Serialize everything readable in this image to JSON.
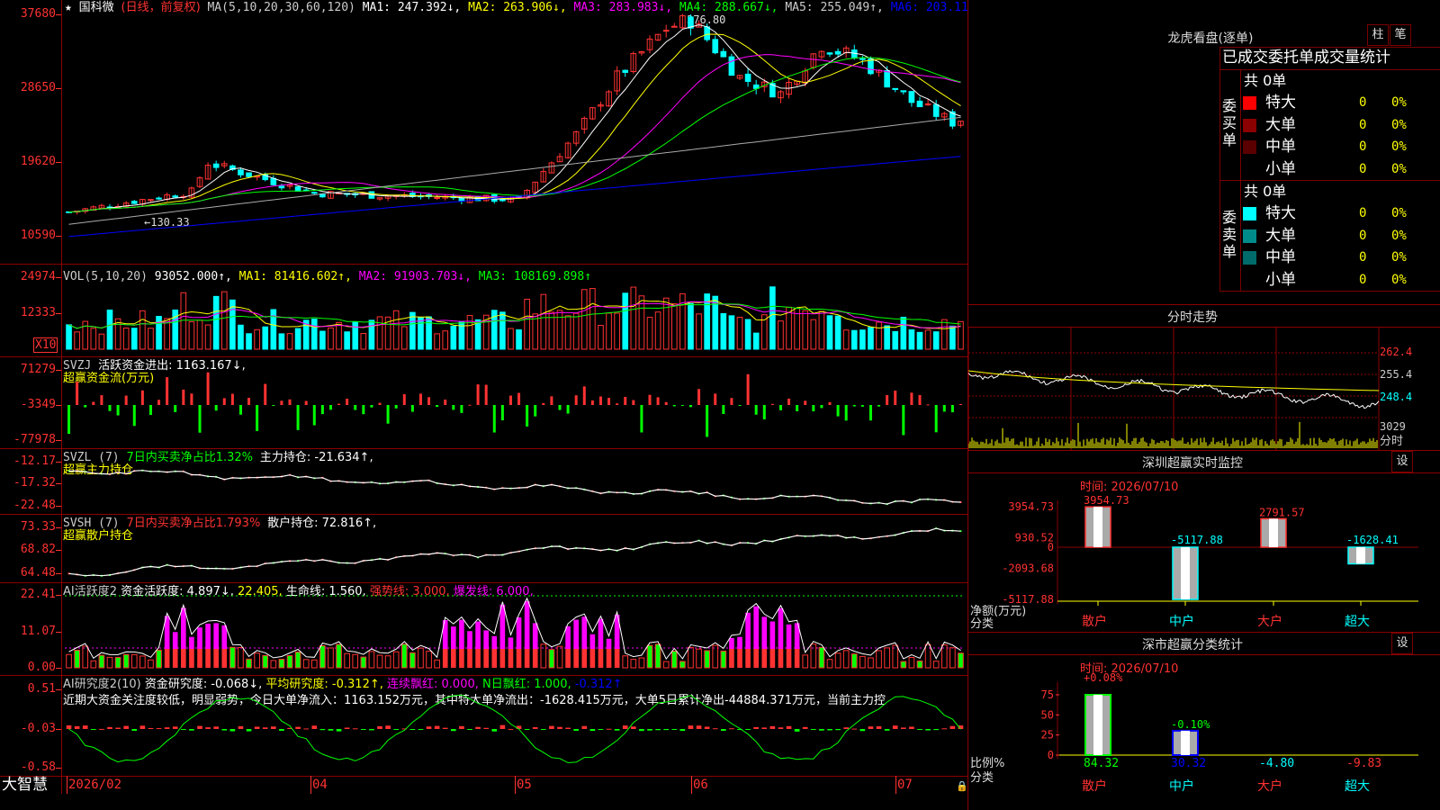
{
  "colors": {
    "up": "#ff3232",
    "down": "#00ffff",
    "bg": "#000000",
    "grid": "#8b0000",
    "ma1": "#ffffff",
    "ma2": "#ffff00",
    "ma3": "#ff00ff",
    "ma4": "#00ff00",
    "ma5": "#aaaaaa",
    "ma6": "#0000ff",
    "magenta": "#ff00ff",
    "green": "#00ff00",
    "yellow": "#ffff00"
  },
  "main": {
    "star": "★",
    "name": "国科微",
    "mode": "(日线，前复权)",
    "ma_label": "MA(5,10,20,30,60,120)",
    "ma1": "MA1: 247.392↓,",
    "ma2": "MA2: 263.906↓,",
    "ma3": "MA3: 283.983↓,",
    "ma4": "MA4: 288.667↓,",
    "ma5": "MA5: 255.049↑,",
    "ma6": "MA6: 203.11",
    "high_mark": "376.80",
    "low_mark": "←130.33",
    "y_labels": [
      "37680",
      "28650",
      "19620",
      "10590"
    ]
  },
  "vol": {
    "label": "VOL(5,10,20)",
    "value": "93052.000↑,",
    "ma1": "MA1: 81416.602↑,",
    "ma2": "MA2: 91903.703↓,",
    "ma3": "MA3: 108169.898↑",
    "y_labels": [
      "24974",
      "12333"
    ],
    "unit": "X10"
  },
  "svzj": {
    "label": "SVZJ",
    "desc": "活跃资金进出: 1163.167↓,",
    "sub": "超赢资金流(万元)",
    "y_labels": [
      "71279",
      "-3349",
      "-77978"
    ]
  },
  "svzl": {
    "label": "SVZL (7)",
    "desc": "7日内买卖净占比1.32%",
    "desc2": "主力持仓: -21.634↑,",
    "sub": "超赢主力持仓",
    "y_labels": [
      "-12.17",
      "-17.32",
      "-22.48"
    ]
  },
  "svsh": {
    "label": "SVSH (7)",
    "desc": "7日内买卖净占比1.793%",
    "desc2": "散户持仓: 72.816↑,",
    "sub": "超赢散户持仓",
    "y_labels": [
      "73.33",
      "68.82",
      "64.48"
    ]
  },
  "ai1": {
    "label": "AI活跃度2",
    "desc": "资金活跃度: 4.897↓,",
    "v2": "22.405,",
    "life": "生命线: 1.560,",
    "strong": "强势线: 3.000,",
    "burst": "爆发线: 6.000,",
    "y_labels": [
      "22.41",
      "11.07",
      "0.00"
    ]
  },
  "ai2": {
    "label": "AI研究度2(10)",
    "desc": "资金研究度: -0.068↓,",
    "avg": "平均研究度: -0.312↑,",
    "cont": "连续飘红: 0.000,",
    "nday": "N日飘红: 1.000,",
    "last": "-0.312↑",
    "comment": "近期大资金关注度较低，明显弱势，今日大单净流入：1163.152万元，其中特大单净流出：-1628.415万元，大单5日累计净出-44884.371万元，当前主力控",
    "y_labels": [
      "0.51",
      "-0.03",
      "-0.58"
    ]
  },
  "footer": {
    "brand": "大智慧",
    "dates": [
      "2026/02",
      "04",
      "05",
      "06",
      "07"
    ]
  },
  "dragon": {
    "title": "龙虎看盘(逐单)",
    "btn_bar": "柱",
    "btn_tick": "笔",
    "header": "已成交委托单成交量统计",
    "buy_label": "委买单",
    "sell_label": "委卖单",
    "buy_total": "共 0单",
    "sell_total": "共 0单",
    "buy_rows": [
      {
        "name": "特大",
        "count": "0",
        "pct": "0%",
        "color": "#ff0000"
      },
      {
        "name": "大单",
        "count": "0",
        "pct": "0%",
        "color": "#8b0000"
      },
      {
        "name": "中单",
        "count": "0",
        "pct": "0%",
        "color": "#5a0000"
      },
      {
        "name": "小单",
        "count": "0",
        "pct": "0%",
        "color": ""
      }
    ],
    "sell_rows": [
      {
        "name": "特大",
        "count": "0",
        "pct": "0%",
        "color": "#00ffff"
      },
      {
        "name": "大单",
        "count": "0",
        "pct": "0%",
        "color": "#008b8b"
      },
      {
        "name": "中单",
        "count": "0",
        "pct": "0%",
        "color": "#006b6b"
      },
      {
        "name": "小单",
        "count": "0",
        "pct": "0%",
        "color": ""
      }
    ]
  },
  "intraday": {
    "title": "分时走势",
    "y_labels": [
      "262.4",
      "255.4",
      "248.4",
      "3029"
    ],
    "vol_unit": "分时"
  },
  "sz_monitor": {
    "title": "深圳超赢实时监控",
    "btn": "设",
    "time": "时间: 2026/07/10",
    "y_labels": [
      "3954.73",
      "930.52",
      "0",
      "-2093.68",
      "-5117.88"
    ],
    "axis_label": "净额(万元)",
    "axis_label2": "分类",
    "bars": [
      {
        "cat": "散户",
        "value": 3954.73,
        "label": "3954.73"
      },
      {
        "cat": "中户",
        "value": -5117.88,
        "label": "-5117.88"
      },
      {
        "cat": "大户",
        "value": 2791.57,
        "label": "2791.57"
      },
      {
        "cat": "超大",
        "value": -1628.41,
        "label": "-1628.41"
      }
    ]
  },
  "sz_class": {
    "title": "深市超赢分类统计",
    "btn": "设",
    "time": "时间: 2026/07/10",
    "y_labels": [
      "75",
      "50",
      "25",
      "0"
    ],
    "axis_label": "比例%",
    "axis_label2": "分类",
    "bars": [
      {
        "cat": "散户",
        "value": 84.32,
        "label": "84.32",
        "change": "+0.08%"
      },
      {
        "cat": "中户",
        "value": 30.32,
        "label": "30.32",
        "change": "-0.10%"
      },
      {
        "cat": "大户",
        "value": -4.8,
        "label": "-4.80",
        "change": ""
      },
      {
        "cat": "超大",
        "value": -9.83,
        "label": "-9.83",
        "change": ""
      }
    ]
  },
  "chart_data": [
    {
      "type": "candlestick",
      "title": "国科微 (日线，前复权)",
      "x_labels": [
        "2026/02",
        "04",
        "05",
        "06",
        "07"
      ],
      "ylim": [
        10590,
        37680
      ],
      "annotations": [
        "376.80",
        "←130.33"
      ],
      "series": [
        {
          "name": "MA1",
          "values": [
            247.392
          ]
        },
        {
          "name": "MA2",
          "values": [
            263.906
          ]
        },
        {
          "name": "MA3",
          "values": [
            283.983
          ]
        },
        {
          "name": "MA4",
          "values": [
            288.667
          ]
        },
        {
          "name": "MA5",
          "values": [
            255.049
          ]
        },
        {
          "name": "MA6",
          "values": [
            203.11
          ]
        }
      ]
    },
    {
      "type": "bar",
      "title": "VOL(5,10,20)",
      "ylim": [
        0,
        24974
      ],
      "series": [
        {
          "name": "VOL",
          "values": [
            93052.0
          ]
        },
        {
          "name": "MA1",
          "values": [
            81416.602
          ]
        },
        {
          "name": "MA2",
          "values": [
            91903.703
          ]
        },
        {
          "name": "MA3",
          "values": [
            108169.898
          ]
        }
      ]
    },
    {
      "type": "bar",
      "title": "深圳超赢实时监控",
      "ylabel": "净额(万元)",
      "categories": [
        "散户",
        "中户",
        "大户",
        "超大"
      ],
      "values": [
        3954.73,
        -5117.88,
        2791.57,
        -1628.41
      ]
    },
    {
      "type": "bar",
      "title": "深市超赢分类统计",
      "ylabel": "比例%",
      "ylim": [
        0,
        75
      ],
      "categories": [
        "散户",
        "中户",
        "大户",
        "超大"
      ],
      "values": [
        84.32,
        30.32,
        -4.8,
        -9.83
      ]
    }
  ]
}
